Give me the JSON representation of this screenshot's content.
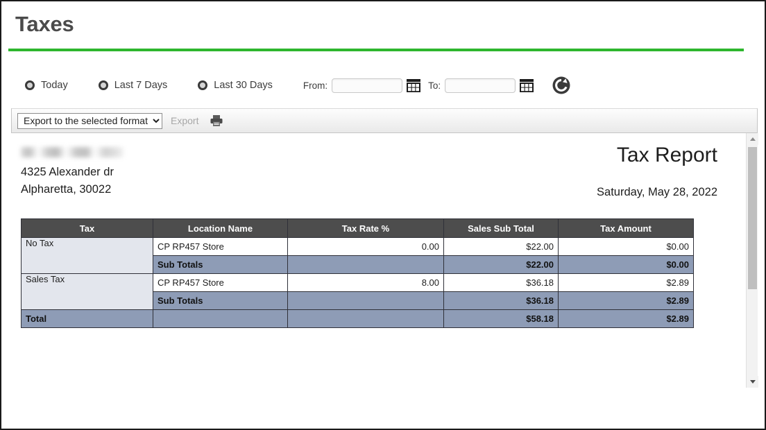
{
  "header": {
    "title": "Taxes",
    "accent_color": "#2eb62e"
  },
  "filters": {
    "radios": [
      {
        "label": "Today",
        "selected": false
      },
      {
        "label": "Last 7 Days",
        "selected": false
      },
      {
        "label": "Last 30 Days",
        "selected": false
      }
    ],
    "from_label": "From:",
    "from_value": "",
    "from_placeholder": "",
    "to_label": "To:",
    "to_value": "",
    "to_placeholder": "",
    "calendar_icon": "calendar-icon",
    "refresh_icon": "refresh-icon"
  },
  "toolbar": {
    "export_format_selected": "Export to the selected format",
    "export_format_options": [
      "Export to the selected format"
    ],
    "export_label": "Export",
    "export_enabled": false,
    "print_icon": "printer-icon"
  },
  "report": {
    "company_name_redacted": true,
    "address_line1": "4325 Alexander dr",
    "address_line2": "Alpharetta,  30022",
    "title": "Tax Report",
    "date": "Saturday, May 28, 2022",
    "columns": [
      "Tax",
      "Location Name",
      "Tax Rate %",
      "Sales Sub Total",
      "Tax Amount"
    ],
    "groups": [
      {
        "tax": "No Tax",
        "rows": [
          {
            "location": "CP RP457 Store",
            "rate": "0.00",
            "sales_sub_total": "$22.00",
            "tax_amount": "$0.00"
          }
        ],
        "subtotal": {
          "label": "Sub Totals",
          "sales_sub_total": "$22.00",
          "tax_amount": "$0.00"
        }
      },
      {
        "tax": "Sales Tax",
        "rows": [
          {
            "location": "CP RP457 Store",
            "rate": "8.00",
            "sales_sub_total": "$36.18",
            "tax_amount": "$2.89"
          }
        ],
        "subtotal": {
          "label": "Sub Totals",
          "sales_sub_total": "$36.18",
          "tax_amount": "$2.89"
        }
      }
    ],
    "total": {
      "label": "Total",
      "sales_sub_total": "$58.18",
      "tax_amount": "$2.89"
    }
  },
  "colors": {
    "table_header_bg": "#4d4d4d",
    "group_cell_bg": "#e3e6ed",
    "subtotal_bg": "#8e9cb6",
    "accent_green": "#2eb62e"
  }
}
